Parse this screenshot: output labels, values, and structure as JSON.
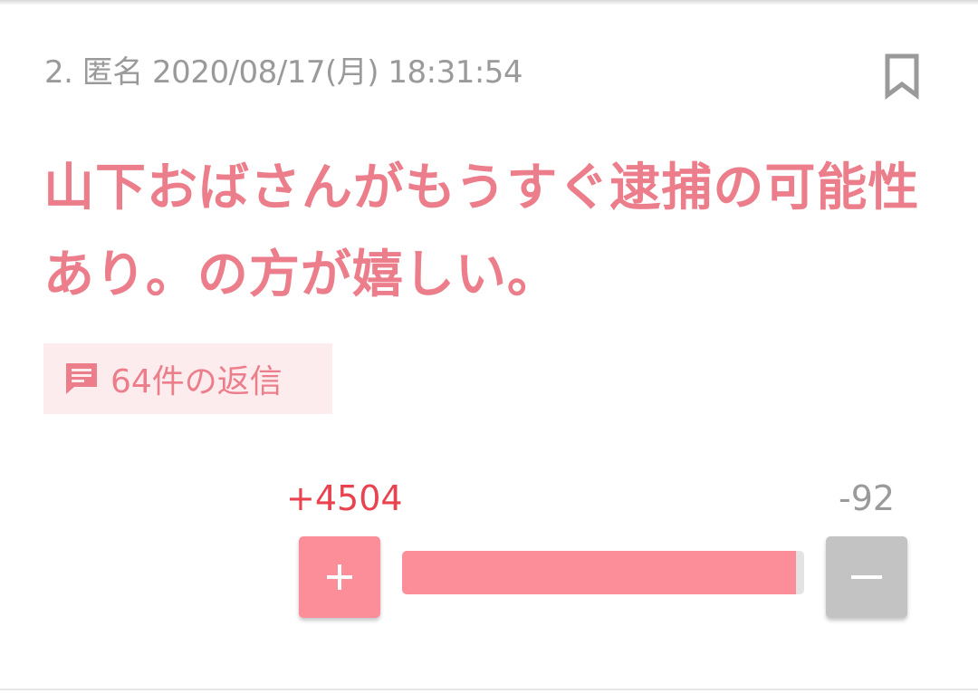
{
  "comment": {
    "meta": "2. 匿名 2020/08/17(月) 18:31:54",
    "text": "山下おばさんがもうすぐ逮捕の可能性あり。の方が嬉しい。",
    "reply_label": "64件の返信"
  },
  "icons": {
    "bookmark": "bookmark-icon",
    "reply": "comment-icon",
    "plus": "plus-icon",
    "minus": "minus-icon"
  },
  "votes": {
    "plus_label": "+4504",
    "minus_label": "-92",
    "plus_fraction": 0.98
  },
  "colors": {
    "accent": "#ec7e8c",
    "plus_count": "#e8434f",
    "plus_button": "#fc8e9a",
    "minus_button": "#c3c3c3",
    "reply_bg": "#fdecee"
  }
}
